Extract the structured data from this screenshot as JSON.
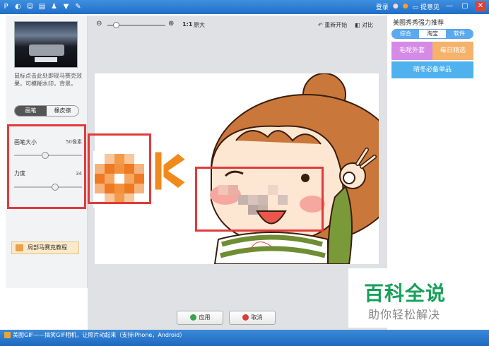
{
  "titlebar": {
    "login": "登录",
    "feedback": "提意见",
    "icons": [
      "gif-icon",
      "mask-icon",
      "smiley-icon",
      "keyboard-icon",
      "person-icon",
      "shirt-icon",
      "tools-icon"
    ]
  },
  "left": {
    "hint": "鼠标点击此处即现马赛克效果，可模糊水印，背景。",
    "tabs": [
      "画笔",
      "橡皮擦"
    ],
    "brush_size_label": "画笔大小",
    "brush_size_value": "50像素",
    "strength_label": "力度",
    "strength_value": "34",
    "brush_size_level": 0.45,
    "strength_level": 0.62,
    "tutorial": "局部马赛克教程"
  },
  "toolbar": {
    "one_to_one": "1:1",
    "original": "原大",
    "restart": "重新开始",
    "compare": "对比"
  },
  "actions": {
    "apply": "应用",
    "cancel": "取消"
  },
  "right": {
    "title": "美图秀秀强力推荐",
    "tabs": [
      "综合",
      "淘宝",
      "软件"
    ],
    "active_tab": "淘宝",
    "promos": [
      "毛呢外套",
      "每日精选",
      "晴冬必备单品"
    ]
  },
  "watermark": {
    "main": "百科全说",
    "sub": "助你轻松解决"
  },
  "status": {
    "text": "美图GIF——搞笑GIF相机，让照片动起来（支持iPhone，Android）"
  },
  "colors": {
    "titlebar": "#1f6fc8",
    "annotation_red": "#e13a3a",
    "arrow_orange": "#f08a1c",
    "watermark_green": "#16a05a"
  }
}
